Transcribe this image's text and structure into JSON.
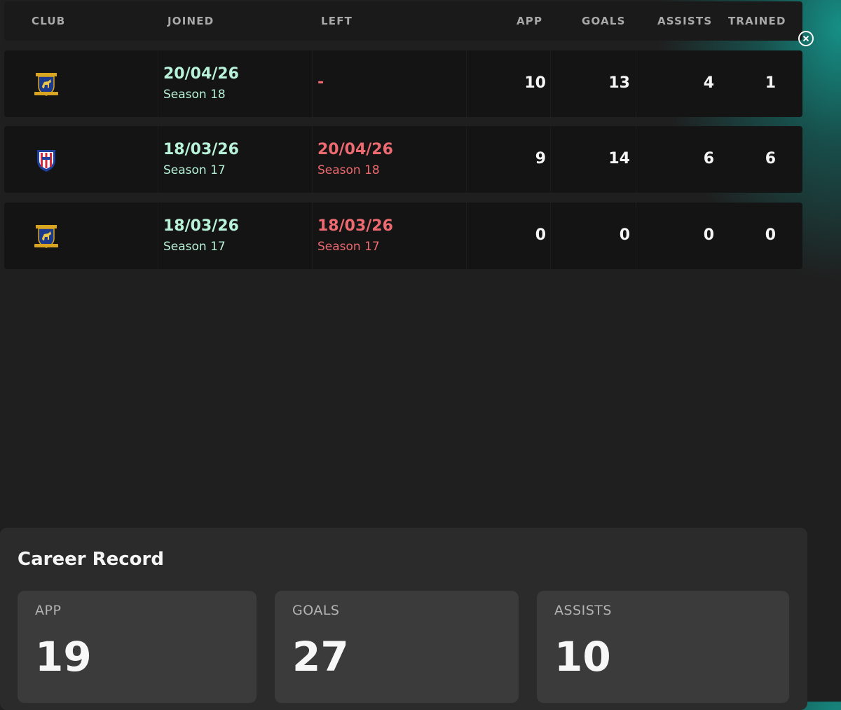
{
  "table": {
    "headers": {
      "club": "CLUB",
      "joined": "JOINED",
      "left": "LEFT",
      "app": "APP",
      "goals": "GOALS",
      "assists": "ASSISTS",
      "trained": "TRAINED"
    },
    "rows": [
      {
        "crest": "horse-shield-crest-icon",
        "joined_date": "20/04/26",
        "joined_season": "Season 18",
        "left_date": "-",
        "left_season": "",
        "app": "10",
        "goals": "13",
        "assists": "4",
        "trained": "1"
      },
      {
        "crest": "striped-shield-crest-icon",
        "joined_date": "18/03/26",
        "joined_season": "Season 17",
        "left_date": "20/04/26",
        "left_season": "Season 18",
        "app": "9",
        "goals": "14",
        "assists": "6",
        "trained": "6"
      },
      {
        "crest": "horse-shield-crest-icon",
        "joined_date": "18/03/26",
        "joined_season": "Season 17",
        "left_date": "18/03/26",
        "left_season": "Season 17",
        "app": "0",
        "goals": "0",
        "assists": "0",
        "trained": "0"
      }
    ]
  },
  "career": {
    "title": "Career Record",
    "cards": [
      {
        "label": "APP",
        "value": "19"
      },
      {
        "label": "GOALS",
        "value": "27"
      },
      {
        "label": "ASSISTS",
        "value": "10"
      }
    ]
  },
  "colors": {
    "joined": "#b8f2d9",
    "left": "#ec6a70",
    "accent_teal": "#15968c"
  },
  "icons": {
    "close": "close-circle-icon"
  }
}
